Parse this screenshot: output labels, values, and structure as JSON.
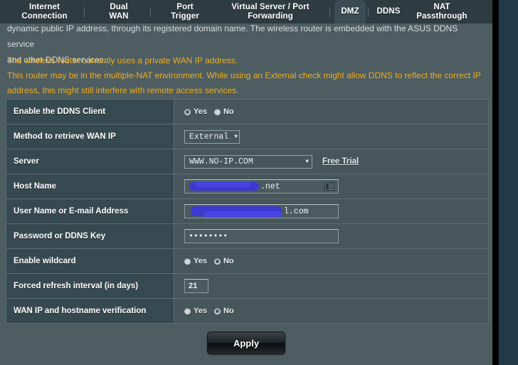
{
  "tabs": [
    {
      "id": "internet-connection",
      "lines": [
        "Internet",
        "Connection"
      ],
      "selected": false
    },
    {
      "id": "dual-wan",
      "lines": [
        "Dual",
        "WAN"
      ],
      "selected": false
    },
    {
      "id": "port-trigger",
      "lines": [
        "Port",
        "Trigger"
      ],
      "selected": false
    },
    {
      "id": "virtual-server-port-forwarding",
      "lines": [
        "Virtual Server / Port",
        "Forwarding"
      ],
      "selected": false
    },
    {
      "id": "dmz",
      "lines": [
        "DMZ"
      ],
      "selected": true
    },
    {
      "id": "ddns",
      "lines": [
        "DDNS"
      ],
      "selected": false
    },
    {
      "id": "nat-passthrough",
      "lines": [
        "NAT",
        "Passthrough"
      ],
      "selected": false
    }
  ],
  "intro": {
    "line1": "dynamic public IP address, through its registered domain name. The wireless router is embedded with the ASUS DDNS service",
    "line2": "and other DDNS services."
  },
  "warnings": {
    "line1": "The wireless router currently uses a private WAN IP address.",
    "line2": "This router may be in the multiple-NAT environment. While using an External check might allow DDNS to reflect the correct IP",
    "line3": "address, this might still interfere with remote access services."
  },
  "form": {
    "enable_ddns_client": {
      "label": "Enable the DDNS Client",
      "yes_label": "Yes",
      "no_label": "No",
      "selected": "Yes"
    },
    "method_wan_ip": {
      "label": "Method to retrieve WAN IP",
      "value": "External",
      "caret": "▼"
    },
    "server": {
      "label": "Server",
      "value": "WWW.NO-IP.COM",
      "caret": "▼",
      "free_trial_label": "Free Trial"
    },
    "host_name": {
      "label": "Host Name",
      "value_suffix": ".net",
      "redacted": true,
      "icon": "contact-card-icon"
    },
    "user_name": {
      "label": "User Name or E-mail Address",
      "value_suffix": "l.com",
      "redacted": true
    },
    "password": {
      "label": "Password or DDNS Key",
      "value": "••••••••"
    },
    "enable_wildcard": {
      "label": "Enable wildcard",
      "yes_label": "Yes",
      "no_label": "No",
      "selected": "No"
    },
    "forced_refresh": {
      "label": "Forced refresh interval (in days)",
      "value": "21"
    },
    "wan_ip_verification": {
      "label": "WAN IP and hostname verification",
      "yes_label": "Yes",
      "no_label": "No",
      "selected": "No"
    }
  },
  "apply_button": {
    "label": "Apply"
  },
  "colors": {
    "panel_bg": "#4d5d61",
    "tab_bg": "#2e3c42",
    "tab_selected_bg": "#3b4c53",
    "label_cell_bg": "#374950",
    "value_cell_bg": "#46565b",
    "warning_text": "#f0ad1e",
    "redaction": "#3b38d8",
    "page_bg": "#21394b"
  }
}
